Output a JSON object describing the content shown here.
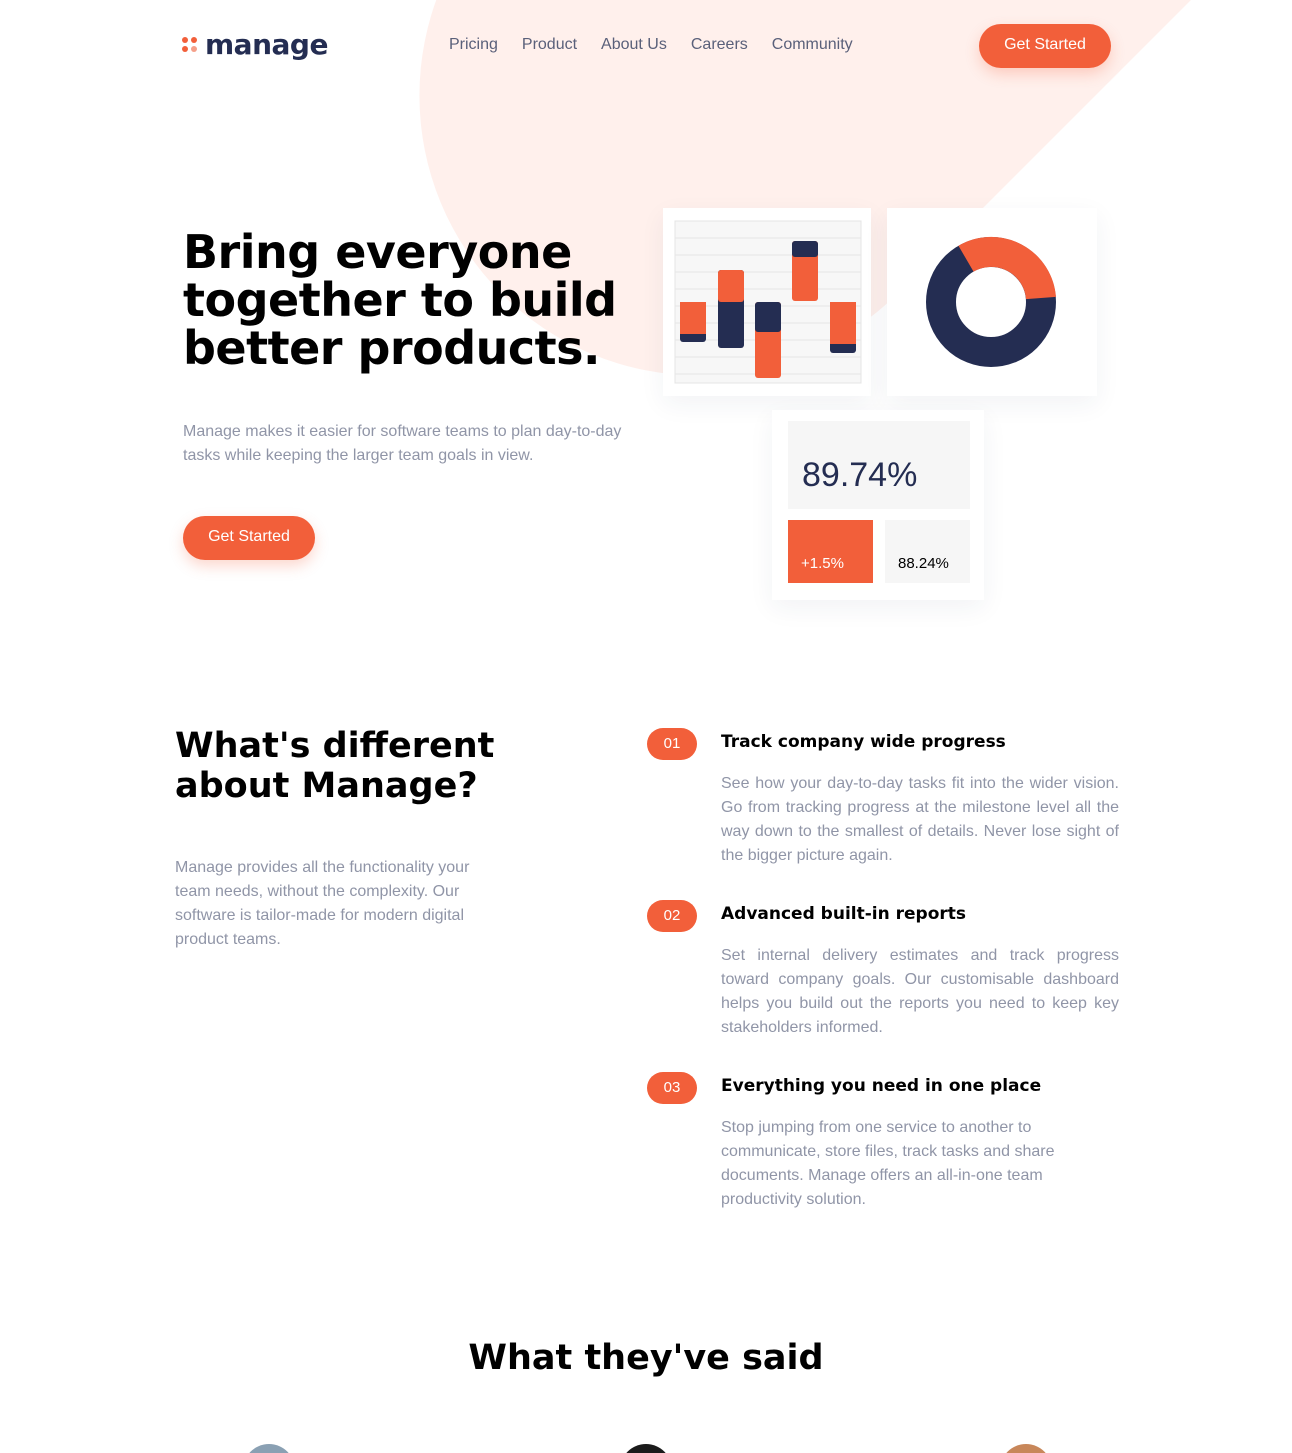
{
  "brand": {
    "name": "manage",
    "accent": "#f25f3a",
    "dark": "#242d52"
  },
  "nav": {
    "items": [
      "Pricing",
      "Product",
      "About Us",
      "Careers",
      "Community"
    ]
  },
  "header": {
    "cta_label": "Get Started"
  },
  "hero": {
    "title": "Bring everyone together to build better products.",
    "text": "Manage makes it easier for software teams to plan day-to-day tasks while keeping the larger team goals in view.",
    "cta_label": "Get Started"
  },
  "dashboard": {
    "main_stat": "89.74%",
    "delta_stat": "+1.5%",
    "secondary_stat": "88.24%"
  },
  "difference": {
    "title": "What's different about Manage?",
    "text": "Manage provides all the functionality your team needs, without the complexity. Our software is tailor-made for modern digital product teams."
  },
  "features": [
    {
      "num": "01",
      "title": "Track company wide progress",
      "desc": "See how your day-to-day tasks fit into the wider vision. Go from tracking progress at the milestone level all the way down to the smallest of details. Never lose sight of the bigger picture again."
    },
    {
      "num": "02",
      "title": "Advanced built-in reports",
      "desc": "Set internal delivery estimates and track progress toward company goals. Our customisable dashboard helps you build out the reports you need to keep key stakeholders informed."
    },
    {
      "num": "03",
      "title": "Everything you need in one place",
      "desc": "Stop jumping from one service to another to communicate, store files, track tasks and share documents. Manage offers an all-in-one team productivity solution."
    }
  ],
  "testimonials": {
    "title": "What they've said"
  }
}
